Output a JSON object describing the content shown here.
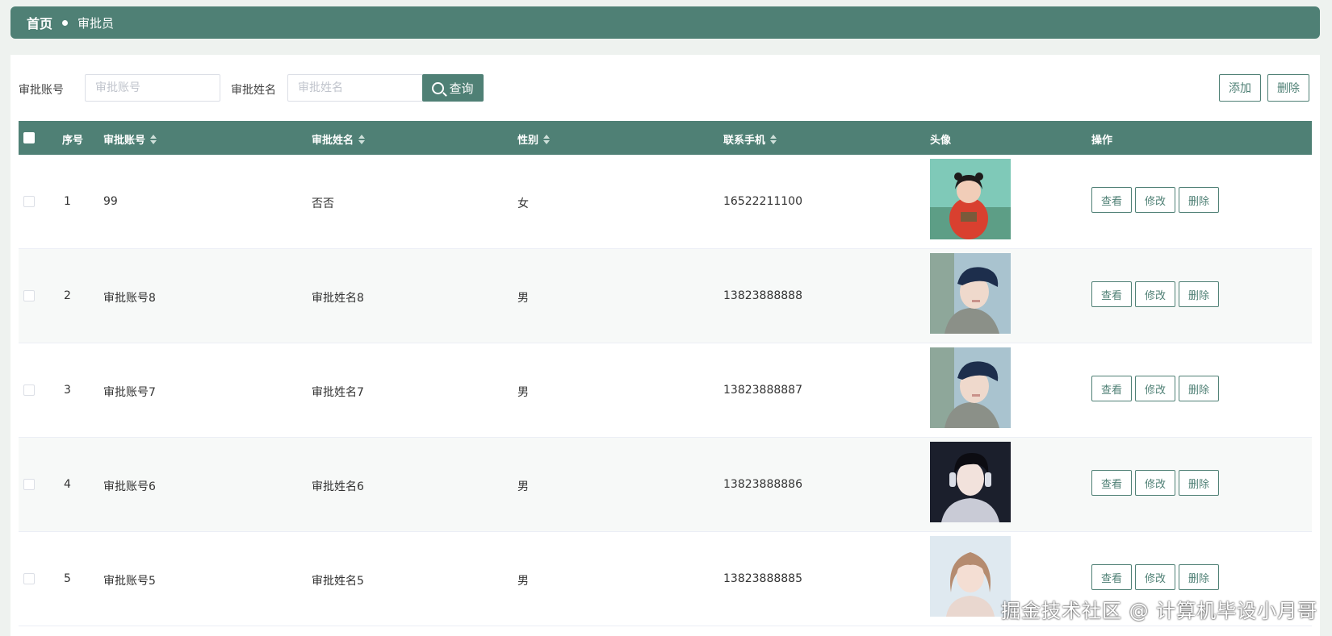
{
  "breadcrumb": {
    "home": "首页",
    "current": "审批员"
  },
  "search": {
    "account_label": "审批账号",
    "account_placeholder": "审批账号",
    "name_label": "审批姓名",
    "name_placeholder": "审批姓名",
    "query_label": "查询",
    "add_label": "添加",
    "delete_label": "删除"
  },
  "table": {
    "headers": {
      "index": "序号",
      "account": "审批账号",
      "name": "审批姓名",
      "gender": "性别",
      "phone": "联系手机",
      "avatar": "头像",
      "actions": "操作"
    },
    "action_labels": {
      "view": "查看",
      "edit": "修改",
      "delete": "删除"
    },
    "rows": [
      {
        "index": "1",
        "account": "99",
        "name": "否否",
        "gender": "女",
        "phone": "16522211100"
      },
      {
        "index": "2",
        "account": "审批账号8",
        "name": "审批姓名8",
        "gender": "男",
        "phone": "13823888888"
      },
      {
        "index": "3",
        "account": "审批账号7",
        "name": "审批姓名7",
        "gender": "男",
        "phone": "13823888887"
      },
      {
        "index": "4",
        "account": "审批账号6",
        "name": "审批姓名6",
        "gender": "男",
        "phone": "13823888886"
      },
      {
        "index": "5",
        "account": "审批账号5",
        "name": "审批姓名5",
        "gender": "男",
        "phone": "13823888885"
      }
    ]
  },
  "watermark": "掘金技术社区 @ 计算机毕设小月哥",
  "colors": {
    "accent": "#4f8075",
    "background": "#eef2ef"
  }
}
